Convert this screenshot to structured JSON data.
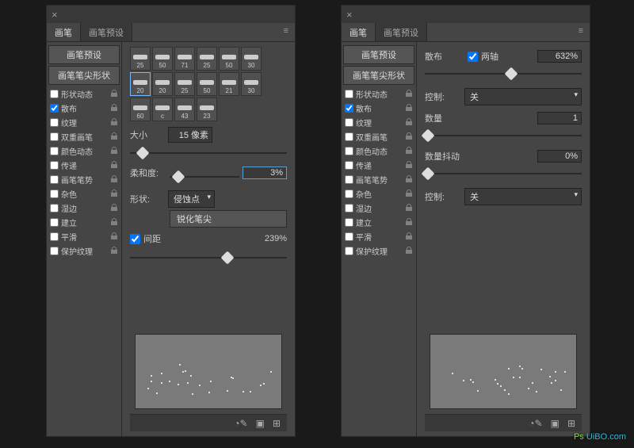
{
  "tabs": {
    "brush": "画笔",
    "preset": "画笔预设"
  },
  "sidebar": {
    "preset_btn": "画笔预设",
    "tip_btn": "画笔笔尖形状",
    "items": [
      {
        "label": "形状动态",
        "checked": false
      },
      {
        "label": "散布",
        "checked": true
      },
      {
        "label": "纹理",
        "checked": false
      },
      {
        "label": "双重画笔",
        "checked": false
      },
      {
        "label": "颜色动态",
        "checked": false
      },
      {
        "label": "传递",
        "checked": false
      },
      {
        "label": "画笔笔势",
        "checked": false
      },
      {
        "label": "杂色",
        "checked": false
      },
      {
        "label": "湿边",
        "checked": false
      },
      {
        "label": "建立",
        "checked": false
      },
      {
        "label": "平滑",
        "checked": false
      },
      {
        "label": "保护纹理",
        "checked": false
      }
    ]
  },
  "left": {
    "brush_sizes": [
      "25",
      "50",
      "71",
      "25",
      "50",
      "30",
      "20",
      "20",
      "25",
      "50",
      "21",
      "30",
      "60",
      "c",
      "43",
      "23"
    ],
    "selected_idx": 6,
    "size_label": "大小",
    "size_val": "15 像素",
    "size_pct": 8,
    "hard_label": "柔和度:",
    "hard_val": "3%",
    "hard_pct": 12,
    "shape_label": "形状:",
    "shape_val": "侵蚀点",
    "sharpen_btn": "锐化笔尖",
    "spacing_label": "间距",
    "spacing_val": "239%",
    "spacing_pct": 62
  },
  "right": {
    "scatter_label": "散布",
    "both_axes": "两轴",
    "both_checked": true,
    "scatter_val": "632%",
    "scatter_pct": 55,
    "control_label": "控制:",
    "control_val": "关",
    "count_label": "数量",
    "count_val": "1",
    "count_pct": 2,
    "jitter_label": "数量抖动",
    "jitter_val": "0%",
    "jitter_pct": 2,
    "control2_val": "关"
  },
  "watermark": "UiBO.com"
}
